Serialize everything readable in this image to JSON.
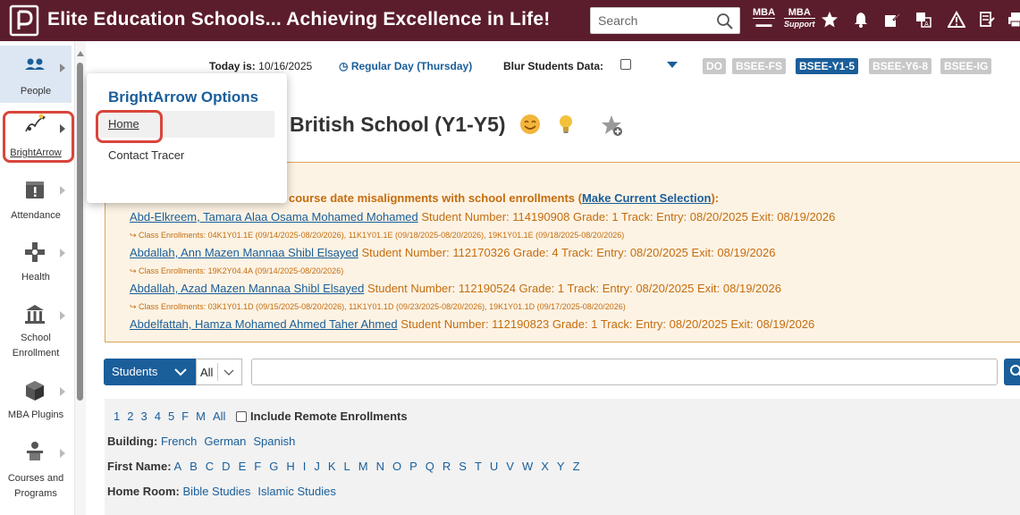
{
  "header": {
    "title": "Elite Education Schools... Achieving Excellence in Life!",
    "search_placeholder": "Search",
    "mba_label": "MBA",
    "mba_support_top": "MBA",
    "mba_support_sub": "Support",
    "bg_color": "#5b1d2c"
  },
  "sidebar": {
    "items": [
      {
        "label": "People",
        "icon": "people-icon"
      },
      {
        "label": "BrightArrow",
        "icon": "brightarrow-icon"
      },
      {
        "label": "Attendance",
        "icon": "attendance-icon"
      },
      {
        "label": "Health",
        "icon": "health-icon"
      },
      {
        "label": "School Enrollment",
        "label_l1": "School",
        "label_l2": "Enrollment",
        "icon": "school-icon"
      },
      {
        "label": "MBA Plugins",
        "icon": "plugin-icon"
      },
      {
        "label": "Courses and Programs",
        "label_l1": "Courses and",
        "label_l2": "Programs",
        "icon": "courses-icon"
      }
    ]
  },
  "topbar": {
    "today_label": "Today is:",
    "today_date": "10/16/2025",
    "day_type": "Regular Day (Thursday)",
    "blur_label": "Blur Students Data:",
    "schools": [
      "DO",
      "BSEE-FS",
      "BSEE-Y1-5",
      "BSEE-Y6-8",
      "BSEE-IG"
    ],
    "active_school": "BSEE-Y1-5"
  },
  "page": {
    "title": "British School (Y1-Y5)"
  },
  "popup": {
    "title": "BrightArrow Options",
    "items": [
      "Home",
      "Contact Tracer"
    ]
  },
  "warning": {
    "title_text": "course date misalignments with school enrollments (",
    "link_text": "Make Current Selection",
    "title_end": "):",
    "students": [
      {
        "name": "Abd-Elkreem, Tamara Alaa Osama Mohamed Mohamed",
        "details": " Student Number: 114190908 Grade: 1 Track: Entry: 08/20/2025 Exit: 08/19/2026",
        "enrollments": "↪ Class Enrollments: 04K1Y01.1E (09/14/2025-08/20/2026), 11K1Y01.1E (09/18/2025-08/20/2026), 19K1Y01.1E (09/18/2025-08/20/2026)"
      },
      {
        "name": "Abdallah, Ann Mazen Mannaa Shibl Elsayed",
        "details": " Student Number: 112170326 Grade: 4 Track: Entry: 08/20/2025 Exit: 08/19/2026",
        "enrollments": "↪ Class Enrollments: 19K2Y04.4A (09/14/2025-08/20/2026)"
      },
      {
        "name": "Abdallah, Azad Mazen Mannaa Shibl Elsayed",
        "details": " Student Number: 112190524 Grade: 1 Track: Entry: 08/20/2025 Exit: 08/19/2026",
        "enrollments": "↪ Class Enrollments: 03K1Y01.1D (09/15/2025-08/20/2026), 11K1Y01.1D (09/23/2025-08/20/2026), 19K1Y01.1D (09/17/2025-08/20/2026)"
      },
      {
        "name": "Abdelfattah, Hamza Mohamed Ahmed Taher Ahmed",
        "details": " Student Number: 112190823 Grade: 1 Track: Entry: 08/20/2025 Exit: 08/19/2026",
        "enrollments": ""
      }
    ]
  },
  "search": {
    "type_label": "Students",
    "scope_label": "All"
  },
  "filters": {
    "grades": [
      "1",
      "2",
      "3",
      "4",
      "5",
      "F",
      "M",
      "All"
    ],
    "remote_label": "Include Remote Enrollments",
    "building_label": "Building:",
    "buildings": [
      "French",
      "German",
      "Spanish"
    ],
    "first_name_label": "First Name:",
    "letters": [
      "A",
      "B",
      "C",
      "D",
      "E",
      "F",
      "G",
      "H",
      "I",
      "J",
      "K",
      "L",
      "M",
      "N",
      "O",
      "P",
      "Q",
      "R",
      "S",
      "T",
      "U",
      "V",
      "W",
      "X",
      "Y",
      "Z"
    ],
    "home_room_label": "Home Room:",
    "home_rooms": [
      "Bible Studies",
      "Islamic Studies"
    ]
  },
  "colors": {
    "accent": "#1a5e9a",
    "warning_text": "#c46d0e",
    "highlight": "#d9453b"
  }
}
